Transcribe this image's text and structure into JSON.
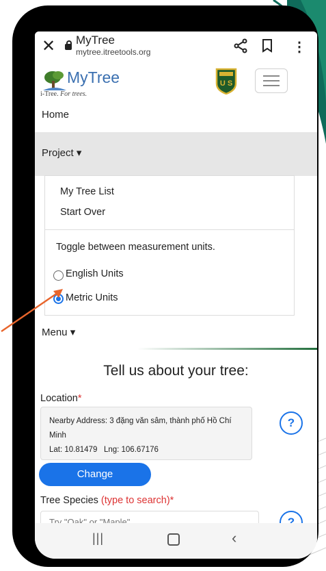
{
  "browser": {
    "page_title": "MyTree",
    "url": "mytree.itreetools.org",
    "close_glyph": "✕",
    "menu_glyph": "⋮"
  },
  "header": {
    "logo_text": "MyTree",
    "logo_brand": "i-Tree.",
    "logo_tagline": "For trees."
  },
  "nav": {
    "home": "Home",
    "project": "Project ▾",
    "dropdown": {
      "items": [
        "My Tree List",
        "Start Over"
      ],
      "units_hint": "Toggle between measurement units.",
      "units": [
        {
          "label": "English Units",
          "selected": false
        },
        {
          "label": "Metric Units",
          "selected": true
        }
      ]
    },
    "menu": "Menu ▾"
  },
  "form": {
    "title": "Tell us about your tree:",
    "location_label": "Location",
    "required_mark": "*",
    "nearby_address": "Nearby Address: 3 đặng văn sâm, thành phố Hồ Chí Minh",
    "lat": "Lat: 10.81479",
    "lng": "Lng: 106.67176",
    "help_glyph": "?",
    "change_button": "Change",
    "species_label": "Tree Species",
    "species_hint": "(type to search)",
    "species_placeholder": "Try \"Oak\" or \"Maple\""
  },
  "system_nav": {
    "recents": "|||",
    "back": "‹"
  },
  "colors": {
    "accent_blue": "#1a73e8",
    "logo_blue": "#3a6fb0",
    "required_red": "#d33333",
    "pointer_orange": "#e8652c",
    "deco_green": "#0f6b5a"
  }
}
